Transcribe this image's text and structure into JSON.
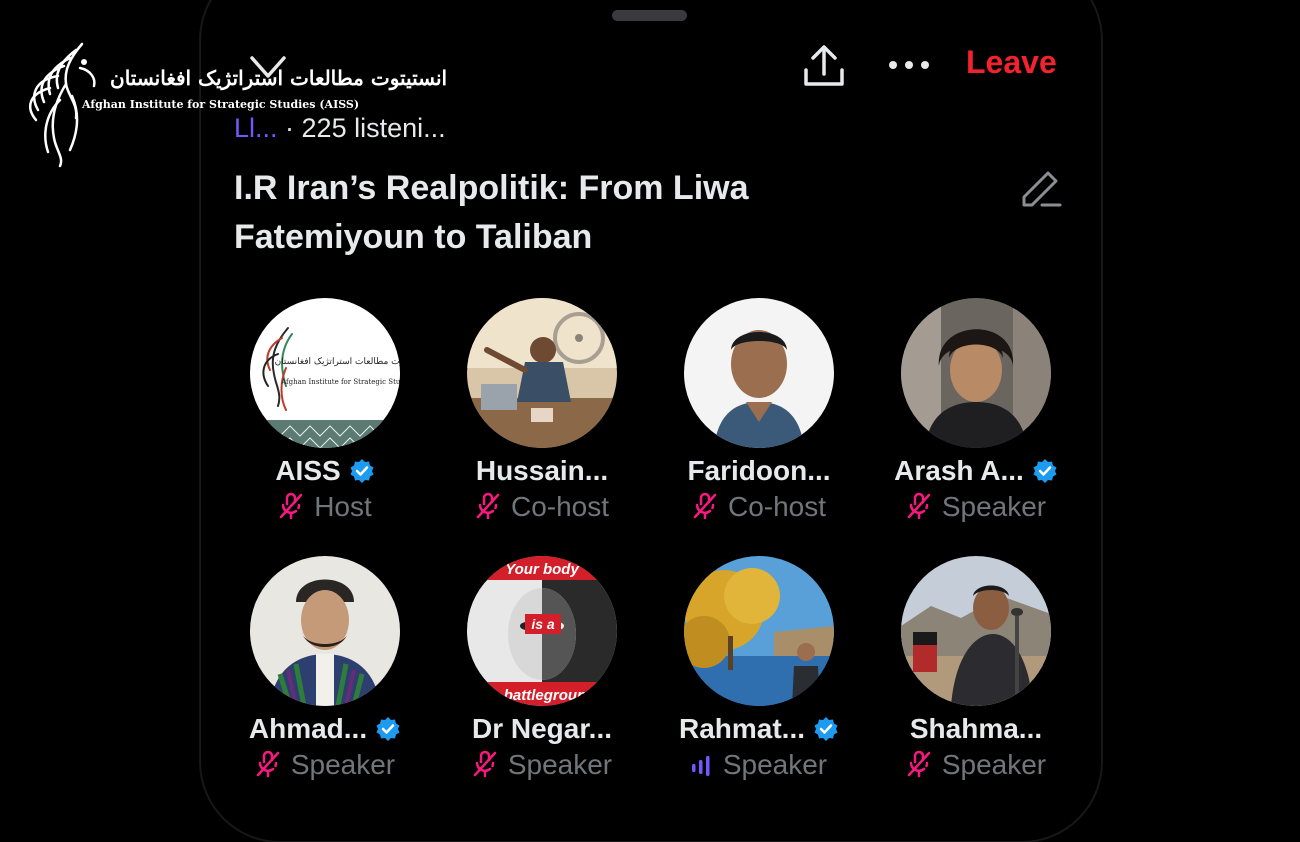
{
  "watermark": {
    "fa_text": "انستیتوت مطالعات استراتژیک افغانستان",
    "en_text": "Afghan Institute for Strategic Studies (AISS)"
  },
  "header": {
    "leave_label": "Leave",
    "language_abbrev": "Ll...",
    "listeners_text": "· 225 listeni..."
  },
  "space": {
    "title": "I.R Iran’s Realpolitik: From Liwa Fatemiyoun to Taliban"
  },
  "participants": [
    {
      "name": "AISS",
      "role": "Host",
      "verified": true,
      "mic": "muted"
    },
    {
      "name": "Hussain...",
      "role": "Co-host",
      "verified": false,
      "mic": "muted"
    },
    {
      "name": "Faridoon...",
      "role": "Co-host",
      "verified": false,
      "mic": "muted"
    },
    {
      "name": "Arash A...",
      "role": "Speaker",
      "verified": true,
      "mic": "muted"
    },
    {
      "name": "Ahmad...",
      "role": "Speaker",
      "verified": true,
      "mic": "muted"
    },
    {
      "name": "Dr Negar...",
      "role": "Speaker",
      "verified": false,
      "mic": "muted"
    },
    {
      "name": "Rahmat...",
      "role": "Speaker",
      "verified": true,
      "mic": "speaking"
    },
    {
      "name": "Shahma...",
      "role": "Speaker",
      "verified": false,
      "mic": "muted"
    }
  ],
  "avatar_art": {
    "aiss_logo_fa": "انستیتوت مطالعات استراتژیک افغانستان",
    "aiss_logo_en": "Afghan Institute for Strategic Studies",
    "negar_poster_top": "Your body",
    "negar_poster_mid": "is a",
    "negar_poster_bottom": "battlegroun"
  },
  "colors": {
    "background": "#000000",
    "accent_red": "#f4212e",
    "mute_pink": "#f91880",
    "verified_blue": "#1d9bf0",
    "language_purple": "#7856ff",
    "secondary_text": "#71767b"
  },
  "icons": {
    "collapse": "chevron-down-icon",
    "share": "share-icon",
    "more": "more-icon",
    "edit": "edit-icon",
    "muted": "mic-off-icon",
    "speaking": "speaking-bars-icon",
    "verified": "verified-badge-icon"
  }
}
